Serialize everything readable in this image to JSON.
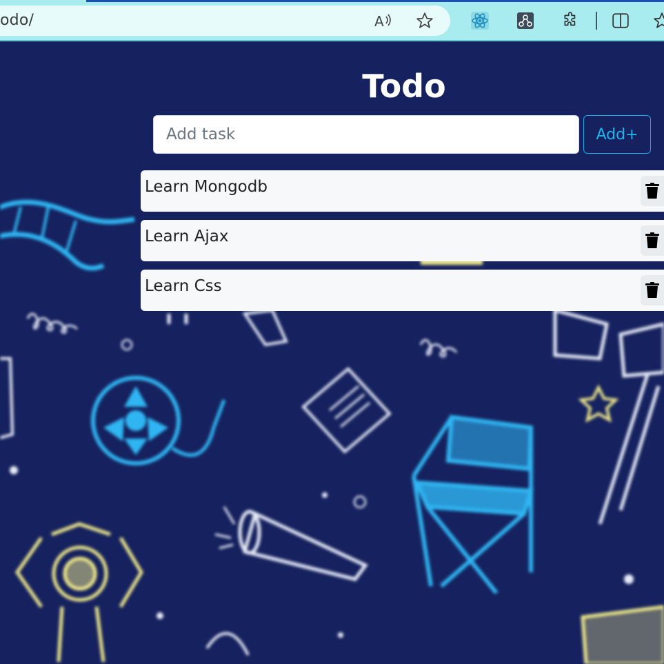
{
  "browser": {
    "url": "odo/",
    "icons": [
      "read-aloud-icon",
      "favorite-star-icon",
      "react-devtools-icon",
      "graph-extension-icon",
      "extensions-puzzle-icon",
      "split-screen-icon",
      "favorites-icon"
    ]
  },
  "app": {
    "title": "Todo",
    "input": {
      "placeholder": "Add task",
      "value": ""
    },
    "add_button_label": "Add+",
    "tasks": [
      {
        "label": "Learn Mongodb"
      },
      {
        "label": "Learn Ajax"
      },
      {
        "label": "Learn Css"
      }
    ]
  },
  "colors": {
    "background": "#16225f",
    "accent": "#21b3ec",
    "browser_bar": "#a8ecef",
    "task_bg": "#f7f8fa"
  }
}
